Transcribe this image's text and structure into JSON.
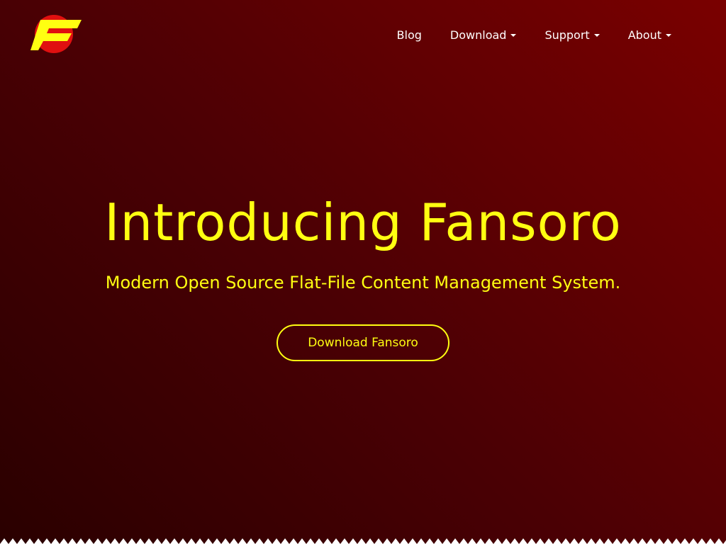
{
  "brand": {
    "logo": "fansoro-f-logo",
    "colors": {
      "yellow": "#ffff11",
      "red": "#e01010",
      "background": "#4a0004"
    }
  },
  "nav": {
    "items": [
      {
        "label": "Blog",
        "dropdown": false
      },
      {
        "label": "Download",
        "dropdown": true
      },
      {
        "label": "Support",
        "dropdown": true
      },
      {
        "label": "About",
        "dropdown": true
      }
    ]
  },
  "hero": {
    "title": "Introducing Fansoro",
    "subtitle": "Modern Open Source Flat-File Content Management System.",
    "cta_label": "Download Fansoro"
  }
}
